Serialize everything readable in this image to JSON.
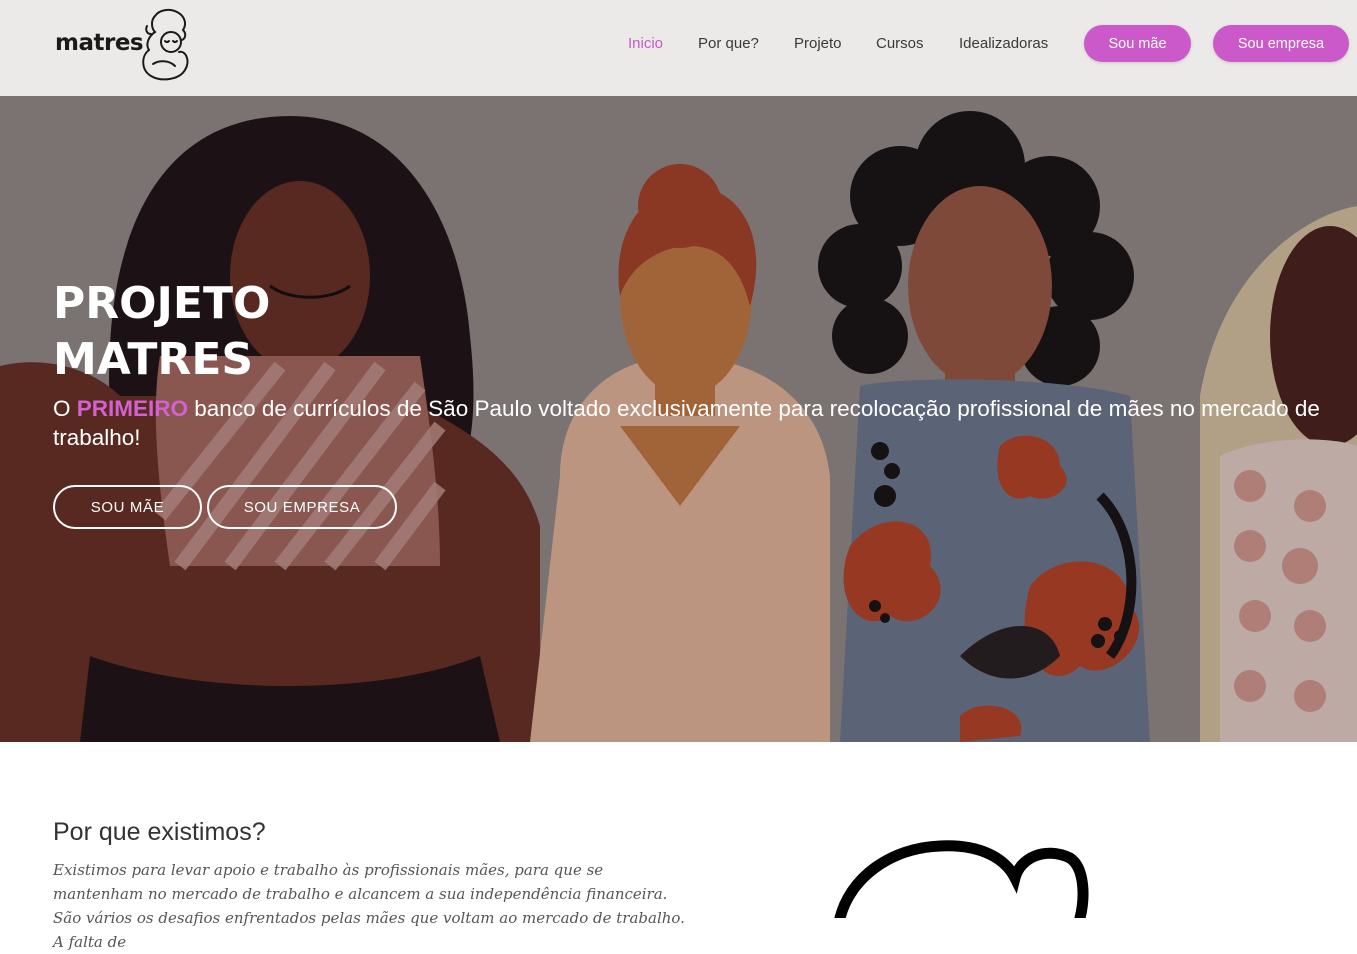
{
  "brand": {
    "name": "matres"
  },
  "nav": {
    "items": [
      {
        "label": "Inicio",
        "active": true
      },
      {
        "label": "Por que?"
      },
      {
        "label": "Projeto"
      },
      {
        "label": "Cursos"
      },
      {
        "label": "Idealizadoras"
      }
    ],
    "buttons": [
      {
        "label": "Sou mãe"
      },
      {
        "label": "Sou empresa"
      }
    ]
  },
  "hero": {
    "title_line1": "PROJETO",
    "title_line2": "MATRES",
    "subtitle_prefix": "O ",
    "subtitle_highlight": "PRIMEIRO",
    "subtitle_rest": " banco de currículos de São Paulo voltado exclusivamente para recolocação profissional de mães no mercado de trabalho!",
    "buttons": [
      {
        "label": "SOU MÃE"
      },
      {
        "label": "SOU EMPRESA"
      }
    ]
  },
  "about": {
    "title": "Por que existimos?",
    "text": "Existimos para levar apoio e trabalho às profissionais mães, para que se mantenham no mercado de trabalho e alcancem a sua independência financeira. São vários os desafios enfrentados pelas mães que voltam ao mercado de trabalho. A falta de"
  },
  "colors": {
    "accent": "#cc59ca",
    "header_bg": "#ebeae8",
    "hero_overlay": "#8e8584"
  },
  "icons": {
    "logo_art": "mother-baby-line-art"
  }
}
